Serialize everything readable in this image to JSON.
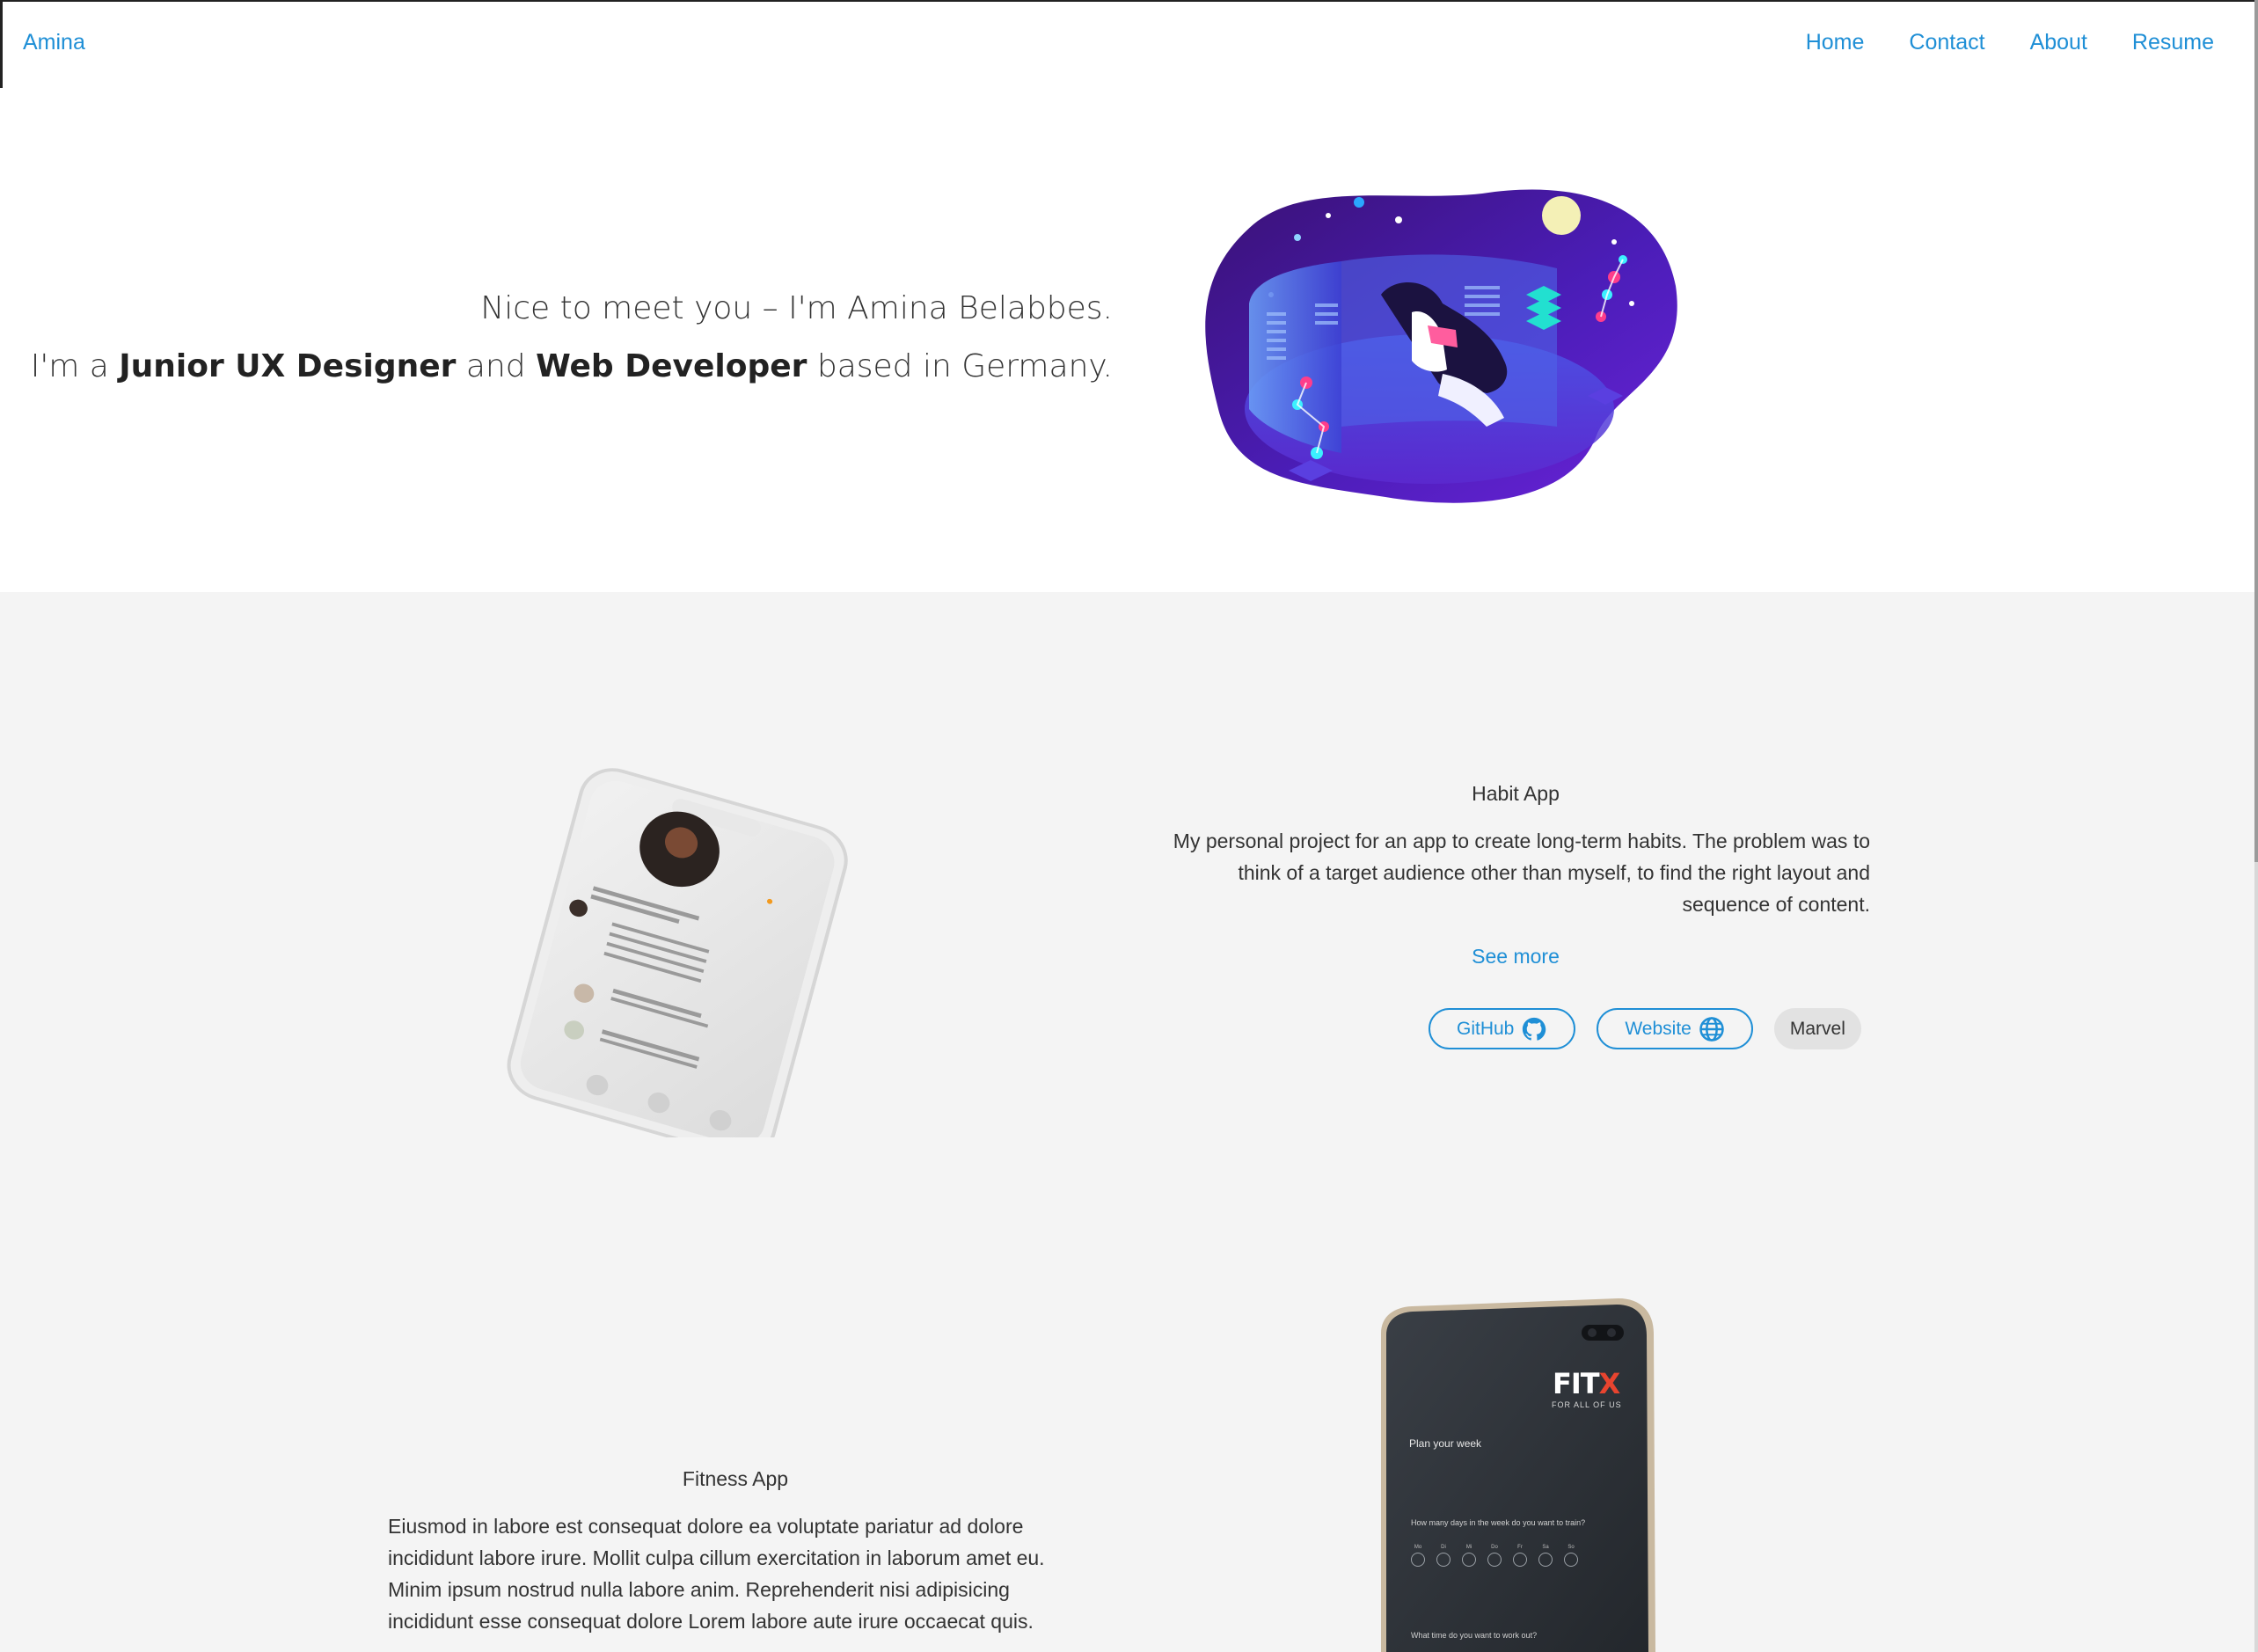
{
  "nav": {
    "brand": "Amina",
    "links": [
      "Home",
      "Contact",
      "About",
      "Resume"
    ]
  },
  "hero": {
    "line1": "Nice to meet you – I'm Amina Belabbes.",
    "line2_prefix": "I'm a ",
    "line2_role1": "Junior UX Designer",
    "line2_and": " and ",
    "line2_role2": "Web Developer",
    "line2_suffix": " based in Germany."
  },
  "projects": [
    {
      "title": "Habit App",
      "description": "My personal project for an app to create long-term habits. The problem was to think of a target audience other than myself, to find the right layout and sequence of content.",
      "see_more": "See more",
      "tags": [
        {
          "label": "GitHub",
          "icon": "github-icon"
        },
        {
          "label": "Website",
          "icon": "globe-icon"
        },
        {
          "label": "Marvel",
          "icon": ""
        }
      ]
    },
    {
      "title": "Fitness App",
      "description": "Eiusmod in labore est consequat dolore ea voluptate pariatur ad dolore incididunt labore irure. Mollit culpa cillum exercitation in laborum amet eu. Minim ipsum nostrud nulla labore anim. Reprehenderit nisi adipisicing incididunt esse consequat dolore Lorem labore aute irure occaecat quis."
    }
  ],
  "fitness_phone": {
    "brand": "FITX",
    "tagline": "FOR ALL OF US",
    "heading": "Plan your week",
    "question1": "How many days in the week do you want to train?",
    "days": [
      "Mo",
      "Di",
      "Mi",
      "Do",
      "Fr",
      "Sa",
      "So"
    ],
    "question2": "What time do you want to work out?"
  },
  "colors": {
    "accent": "#1f8fd6",
    "section_bg": "#f4f4f4",
    "pill_bg": "#e2e2e2"
  }
}
